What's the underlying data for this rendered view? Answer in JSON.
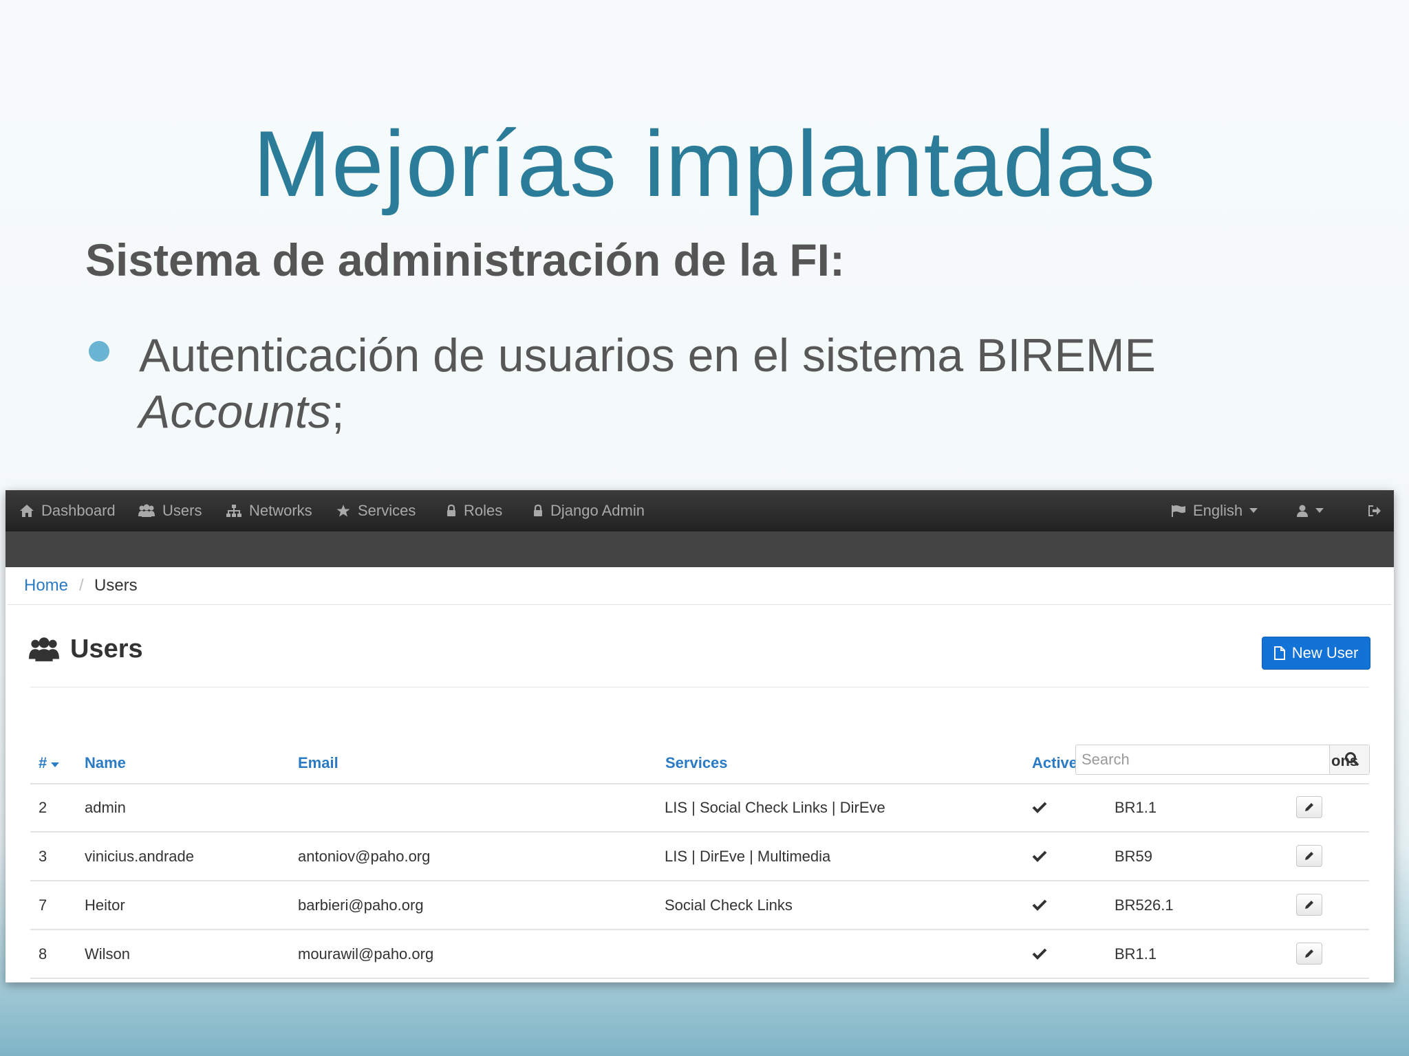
{
  "slide": {
    "title": "Mejorías implantadas",
    "subtitle": "Sistema de administración de la FI:",
    "bullet_text": "Autenticación de usuarios en el sistema BIREME",
    "bullet_italic": "Accounts",
    "bullet_end": ";"
  },
  "navbar": {
    "items": [
      "Dashboard",
      "Users",
      "Networks",
      "Services",
      "Roles",
      "Django Admin"
    ],
    "language": "English"
  },
  "breadcrumb": {
    "home": "Home",
    "separator": "/",
    "current": "Users"
  },
  "page": {
    "title": "Users",
    "new_user_label": "New User"
  },
  "table": {
    "headers": {
      "id": "#",
      "name": "Name",
      "email": "Email",
      "services": "Services",
      "active": "Active",
      "actions_fragment": "ons"
    },
    "search_placeholder": "Search",
    "rows": [
      {
        "id": "2",
        "name": "admin",
        "email": "",
        "services": "LIS | Social Check Links | DirEve",
        "cc": "BR1.1"
      },
      {
        "id": "3",
        "name": "vinicius.andrade",
        "email": "antoniov@paho.org",
        "services": "LIS | DirEve | Multimedia",
        "cc": "BR59"
      },
      {
        "id": "7",
        "name": "Heitor",
        "email": "barbieri@paho.org",
        "services": "Social Check Links",
        "cc": "BR526.1"
      },
      {
        "id": "8",
        "name": "Wilson",
        "email": "mourawil@paho.org",
        "services": "",
        "cc": "BR1.1"
      }
    ]
  },
  "colors": {
    "title": "#2b7c99",
    "link": "#2a7ac4",
    "primary_button": "#1372d6",
    "navbar": "#2b2b2b"
  }
}
